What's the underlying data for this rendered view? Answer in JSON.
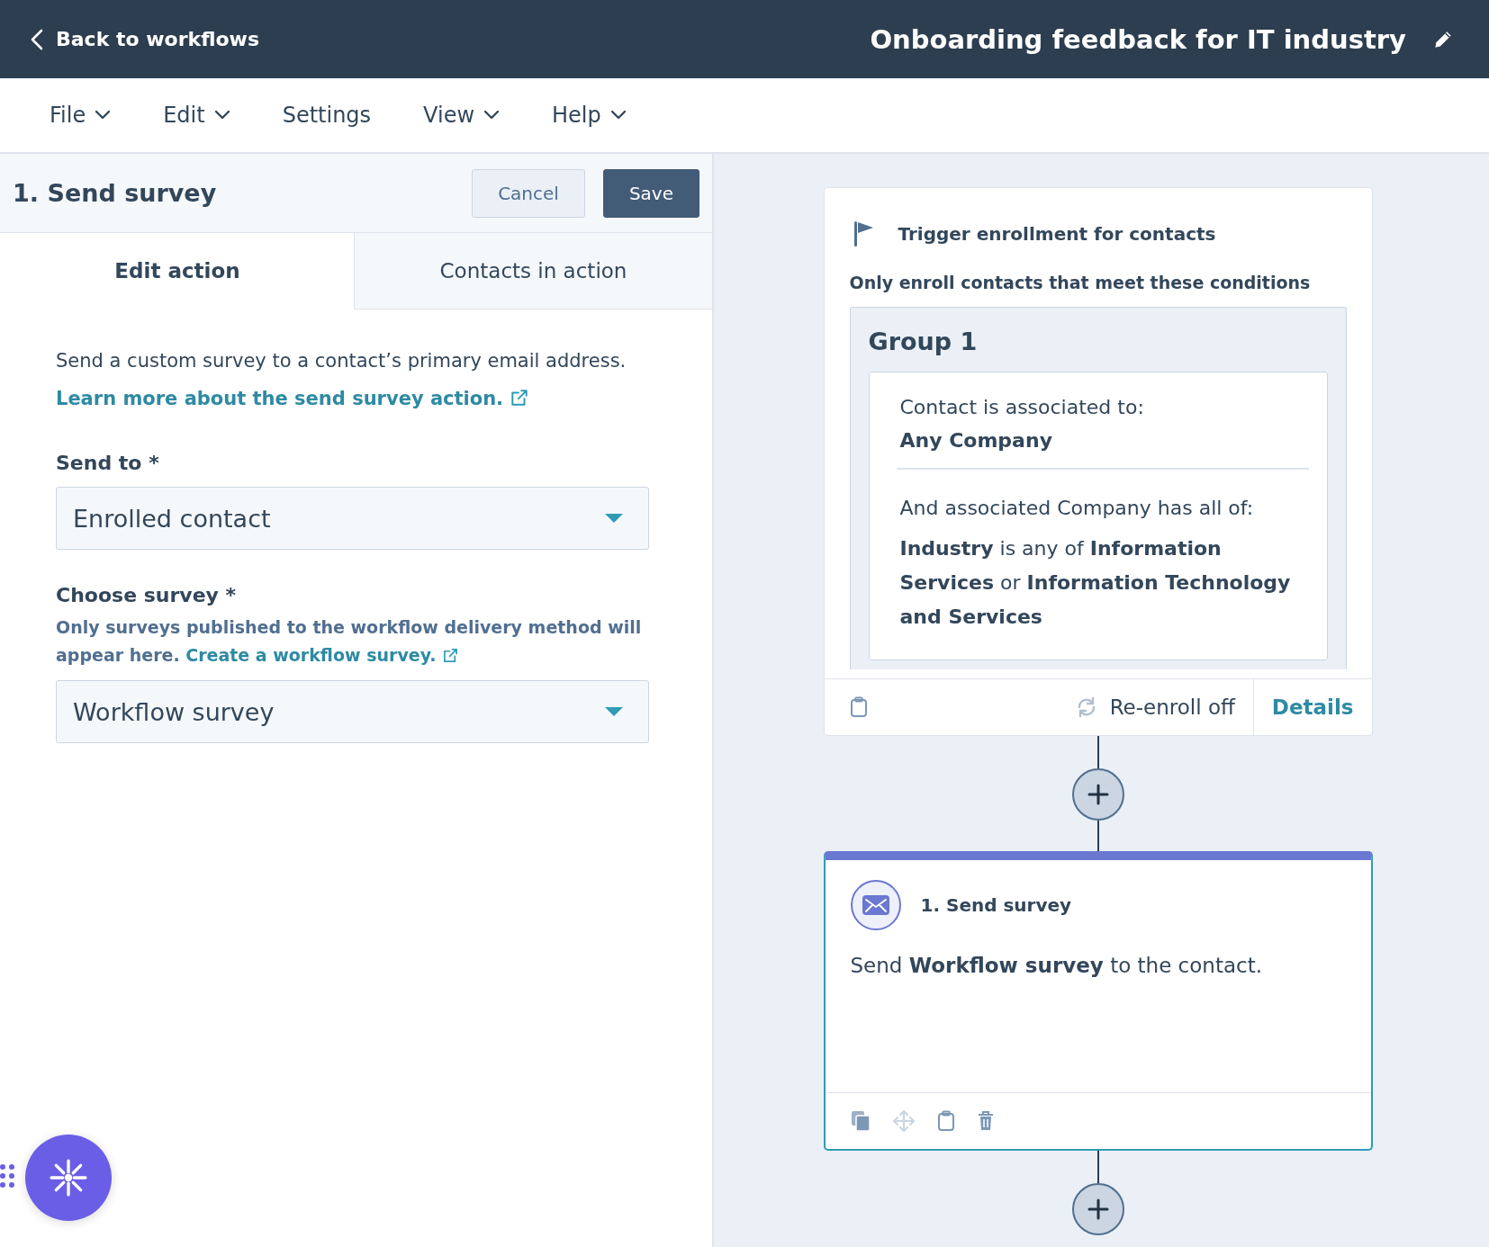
{
  "header": {
    "back_link": "Back to workflows",
    "title": "Onboarding feedback for IT industry"
  },
  "menu": [
    {
      "label": "File",
      "dropdown": true
    },
    {
      "label": "Edit",
      "dropdown": true
    },
    {
      "label": "Settings",
      "dropdown": false
    },
    {
      "label": "View",
      "dropdown": true
    },
    {
      "label": "Help",
      "dropdown": true
    }
  ],
  "panel": {
    "title": "1. Send survey",
    "cancel": "Cancel",
    "save": "Save",
    "tabs": [
      {
        "label": "Edit action",
        "selected": true
      },
      {
        "label": "Contacts in action",
        "selected": false
      }
    ],
    "description": "Send a custom survey to a contact’s primary email address.",
    "description_link": "Learn more about the send survey action.",
    "fields": [
      {
        "label": "Send to *",
        "value": "Enrolled contact"
      },
      {
        "label": "Choose survey *",
        "help": "Only surveys published to the workflow delivery method will appear here.",
        "help_link": "Create a workflow survey.",
        "value": "Workflow survey"
      }
    ]
  },
  "trigger": {
    "title": "Trigger enrollment for contacts",
    "subtitle": "Only enroll contacts that meet these conditions",
    "group": {
      "title": "Group 1",
      "association": "Contact is associated to:",
      "association_value": "Any Company",
      "filter_intro": "And associated Company has all of:",
      "filter": "**Industry** is any of **Information Services** or **Information Technology and Services**"
    },
    "reenroll": "Re-enroll off",
    "details": "Details"
  },
  "action": {
    "title": "1. Send survey",
    "body": "Send **Workflow survey** to the contact."
  }
}
